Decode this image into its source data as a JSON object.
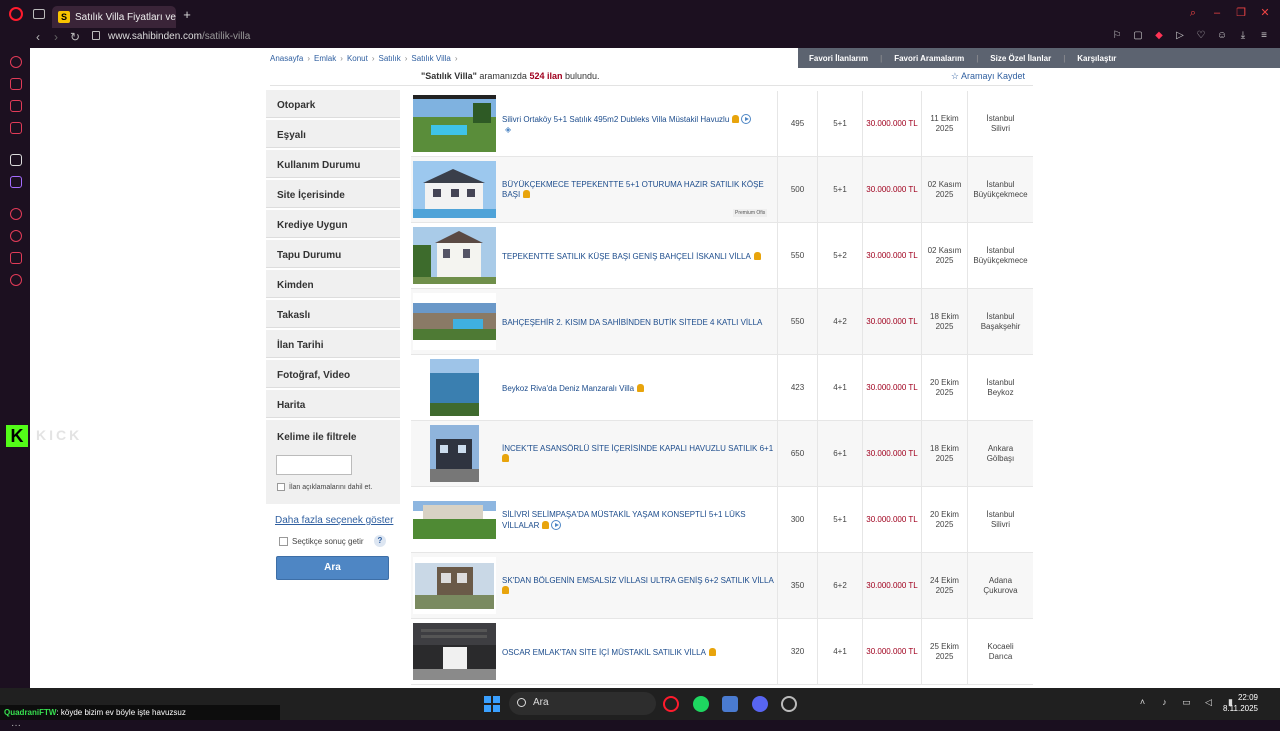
{
  "browser": {
    "tab_title": "Satılık Villa Fiyatları ve Vil",
    "tab_favicon_letter": "S",
    "url_host": "www.sahibinden.com",
    "url_path": "/satilik-villa"
  },
  "breadcrumb": [
    "Anasayfa",
    "Emlak",
    "Konut",
    "Satılık",
    "Satılık Villa"
  ],
  "quicklinks": [
    "Favori İlanlarım",
    "Favori Aramalarım",
    "Size Özel İlanlar",
    "Karşılaştır"
  ],
  "result": {
    "query": "\"Satılık Villa\"",
    "middle": " aramanızda ",
    "count": "524 ilan",
    "suffix": " bulundu.",
    "save_search": "☆ Aramayı Kaydet"
  },
  "filters": [
    "Otopark",
    "Eşyalı",
    "Kullanım Durumu",
    "Site İçerisinde",
    "Krediye Uygun",
    "Tapu Durumu",
    "Kimden",
    "Takaslı",
    "İlan Tarihi",
    "Fotoğraf, Video",
    "Harita"
  ],
  "keyword": {
    "label": "Kelime ile filtrele",
    "value": "",
    "checkbox_label": "İlan açıklamalarını dahil et."
  },
  "more_options": "Daha fazla seçenek göster",
  "select_results_label": "Seçtikçe sonuç getir",
  "help_label": "?",
  "search_button": "Ara",
  "listings": [
    {
      "title": "Silivri Ortaköy 5+1 Satılık 495m2 Dubleks Villa Müstakil Havuzlu",
      "m2": "495",
      "rooms": "5+1",
      "price": "30.000.000 TL",
      "date1": "11 Ekim",
      "date2": "2025",
      "city": "İstanbul",
      "district": "Silivri",
      "icons": [
        "pin-icon",
        "play-icon",
        "tour360-icon"
      ]
    },
    {
      "title": "BÜYÜKÇEKMECE TEPEKENTTE 5+1 OTURUMA HAZIR SATILIK KÖŞE BAŞI",
      "m2": "500",
      "rooms": "5+1",
      "price": "30.000.000 TL",
      "date1": "02 Kasım",
      "date2": "2025",
      "city": "İstanbul",
      "district": "Büyükçekmece",
      "icons": [
        "pin-icon"
      ],
      "premium": "Premium Ofis"
    },
    {
      "title": "TEPEKENTTE SATILIK KÜŞE BAŞI GENİŞ BAHÇELİ İSKANLI VİLLA",
      "m2": "550",
      "rooms": "5+2",
      "price": "30.000.000 TL",
      "date1": "02 Kasım",
      "date2": "2025",
      "city": "İstanbul",
      "district": "Büyükçekmece",
      "icons": [
        "pin-icon"
      ]
    },
    {
      "title": "BAHÇEŞEHİR 2. KISIM DA SAHİBİNDEN BUTİK SİTEDE 4 KATLI VİLLA",
      "m2": "550",
      "rooms": "4+2",
      "price": "30.000.000 TL",
      "date1": "18 Ekim",
      "date2": "2025",
      "city": "İstanbul",
      "district": "Başakşehir",
      "icons": []
    },
    {
      "title": "Beykoz Riva'da Deniz Manzaralı Villa",
      "m2": "423",
      "rooms": "4+1",
      "price": "30.000.000 TL",
      "date1": "20 Ekim",
      "date2": "2025",
      "city": "İstanbul",
      "district": "Beykoz",
      "icons": [
        "pin-icon"
      ]
    },
    {
      "title": "İNCEK'TE ASANSÖRLÜ SİTE İÇERİSİNDE KAPALI HAVUZLU SATILIK 6+1",
      "m2": "650",
      "rooms": "6+1",
      "price": "30.000.000 TL",
      "date1": "18 Ekim",
      "date2": "2025",
      "city": "Ankara",
      "district": "Gölbaşı",
      "icons": [
        "pin-icon"
      ]
    },
    {
      "title": "SİLİVRİ SELİMPAŞA'DA MÜSTAKİL YAŞAM KONSEPTLİ 5+1 LÜKS VİLLALAR",
      "m2": "300",
      "rooms": "5+1",
      "price": "30.000.000 TL",
      "date1": "20 Ekim",
      "date2": "2025",
      "city": "İstanbul",
      "district": "Silivri",
      "icons": [
        "pin-icon",
        "play-icon"
      ]
    },
    {
      "title": "SK'DAN BÖLGENİN EMSALSİZ VİLLASI ULTRA GENİŞ 6+2 SATILIK VİLLA",
      "m2": "350",
      "rooms": "6+2",
      "price": "30.000.000 TL",
      "date1": "24 Ekim",
      "date2": "2025",
      "city": "Adana",
      "district": "Çukurova",
      "icons": [
        "pin-icon"
      ]
    },
    {
      "title": "OSCAR EMLAK'TAN SİTE İÇİ MÜSTAKİL SATILIK VİLLA",
      "m2": "320",
      "rooms": "4+1",
      "price": "30.000.000 TL",
      "date1": "25 Ekim",
      "date2": "2025",
      "city": "Kocaeli",
      "district": "Darıca",
      "icons": [
        "pin-icon"
      ]
    }
  ],
  "taskbar": {
    "search_placeholder": "Ara",
    "time": "22:09",
    "date": "8.11.2025"
  },
  "stream_chat": {
    "user": "QuadraniFTW",
    "message": ": köyde bizim ev böyle işte havuzsuz"
  },
  "overlay": {
    "logo_letter": "K",
    "watermark": "KICK"
  }
}
